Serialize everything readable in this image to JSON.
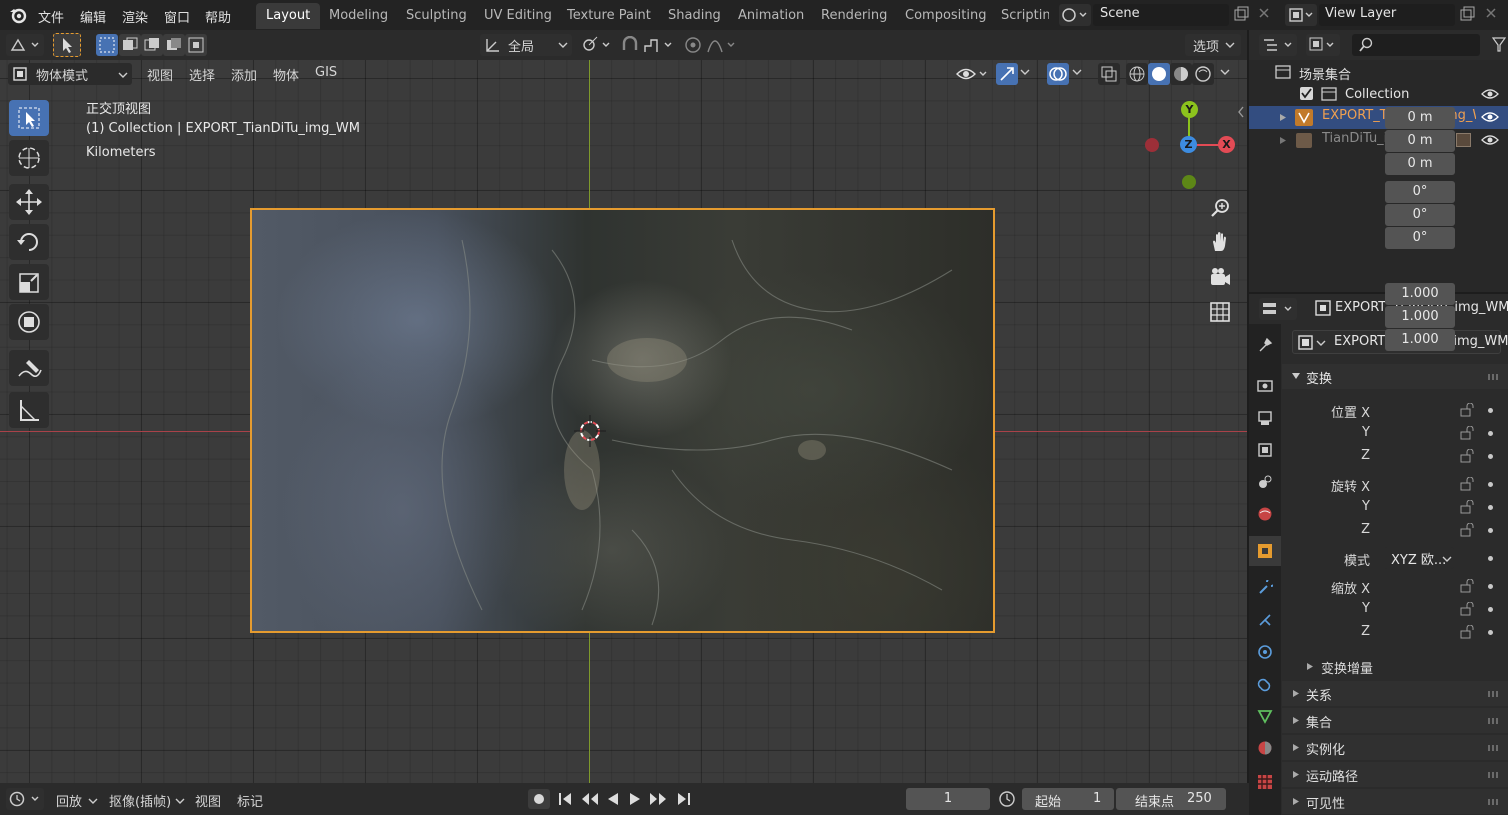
{
  "menu": {
    "file": "文件",
    "edit": "编辑",
    "render": "渲染",
    "window": "窗口",
    "help": "帮助"
  },
  "workspaces": [
    "Layout",
    "Modeling",
    "Sculpting",
    "UV Editing",
    "Texture Paint",
    "Shading",
    "Animation",
    "Rendering",
    "Compositing",
    "Scriptin"
  ],
  "scene": {
    "label": "Scene"
  },
  "view_layer": {
    "label": "View Layer"
  },
  "tool_header": {
    "transform_orientation": "全局",
    "options": "选项"
  },
  "viewport_header": {
    "mode": "物体模式",
    "view": "视图",
    "select": "选择",
    "add": "添加",
    "object": "物体",
    "gis": "GIS"
  },
  "overlay_text": {
    "view_name": "正交顶视图",
    "collection_line": "(1) Collection | EXPORT_TianDiTu_img_WM",
    "units": "Kilometers"
  },
  "gizmo": {
    "y": "Y",
    "z": "Z",
    "x": "X"
  },
  "outliner": {
    "root": "场景集合",
    "collection": "Collection",
    "items": [
      {
        "label": "EXPORT_TianDiTu_img_WM",
        "selected": true
      },
      {
        "label": "TianDiTu_img_WM",
        "selected": false
      }
    ]
  },
  "properties": {
    "object_name_header": "EXPORT_TianDiTu_img_WM",
    "object_name_field": "EXPORT_TianDiTu_img_WM",
    "transform_panel": "变换",
    "location_label": "位置 X",
    "location": [
      "0 m",
      "0 m",
      "0 m"
    ],
    "rotation_label": "旋转 X",
    "rotation": [
      "0°",
      "0°",
      "0°"
    ],
    "mode_label": "模式",
    "mode_value": "XYZ 欧...",
    "scale_label": "缩放 X",
    "scale": [
      "1.000",
      "1.000",
      "1.000"
    ],
    "axis_y": "Y",
    "axis_z": "Z",
    "delta_transform": "变换增量",
    "panels": [
      "关系",
      "集合",
      "实例化",
      "运动路径",
      "可见性"
    ]
  },
  "timeline": {
    "playback": "回放",
    "keying": "抠像(插帧)",
    "view": "视图",
    "marker": "标记",
    "current_frame": "1",
    "start_label": "起始",
    "start": "1",
    "end_label": "结束点",
    "end": "250"
  },
  "colors": {
    "accent": "#4772b3",
    "selection": "#e59b2f",
    "x_axis": "#e24b55",
    "y_axis": "#8cc31d",
    "z_axis": "#3d8ce0"
  }
}
